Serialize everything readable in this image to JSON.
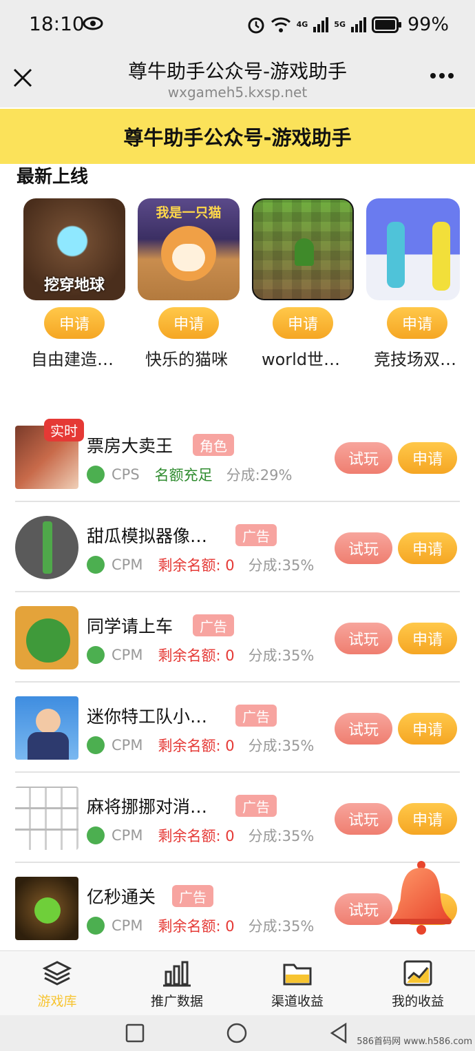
{
  "status_bar": {
    "time": "18:10",
    "battery_pct": "99%",
    "network_1": "4G",
    "network_2": "5G"
  },
  "title_bar": {
    "title": "尊牛助手公众号-游戏助手",
    "url": "wxgameh5.kxsp.net"
  },
  "banner": {
    "text": "尊牛助手公众号-游戏助手"
  },
  "newest": {
    "title": "最新上线",
    "items": [
      {
        "name": "自由建造…",
        "button": "申请",
        "thumb_text": "挖穿地球"
      },
      {
        "name": "快乐的猫咪",
        "button": "申请",
        "thumb_text": "我是一只猫"
      },
      {
        "name": "world世…",
        "button": "申请",
        "thumb_text": ""
      },
      {
        "name": "竞技场双…",
        "button": "申请",
        "thumb_text": ""
      }
    ]
  },
  "games": [
    {
      "name": "票房大卖王",
      "tag": "角色",
      "badge": "实时",
      "type": "CPS",
      "quota": "名额充足",
      "quota_color": "#2e8b2e",
      "share": "分成:29%",
      "try": "试玩",
      "apply": "申请"
    },
    {
      "name": "甜瓜模拟器像…",
      "tag": "广告",
      "badge": "",
      "type": "CPM",
      "quota": "剩余名额: 0",
      "quota_color": "#e53935",
      "share": "分成:35%",
      "try": "试玩",
      "apply": "申请"
    },
    {
      "name": "同学请上车",
      "tag": "广告",
      "badge": "",
      "type": "CPM",
      "quota": "剩余名额: 0",
      "quota_color": "#e53935",
      "share": "分成:35%",
      "try": "试玩",
      "apply": "申请"
    },
    {
      "name": "迷你特工队小…",
      "tag": "广告",
      "badge": "",
      "type": "CPM",
      "quota": "剩余名额: 0",
      "quota_color": "#e53935",
      "share": "分成:35%",
      "try": "试玩",
      "apply": "申请"
    },
    {
      "name": "麻将挪挪对消…",
      "tag": "广告",
      "badge": "",
      "type": "CPM",
      "quota": "剩余名额: 0",
      "quota_color": "#e53935",
      "share": "分成:35%",
      "try": "试玩",
      "apply": "申请"
    },
    {
      "name": "亿秒通关",
      "tag": "广告",
      "badge": "",
      "type": "CPM",
      "quota": "剩余名额: 0",
      "quota_color": "#e53935",
      "share": "分成:35%",
      "try": "试玩",
      "apply": "申请"
    }
  ],
  "tabs": [
    {
      "label": "游戏库",
      "icon": "layers-icon",
      "active": true
    },
    {
      "label": "推广数据",
      "icon": "bar-chart-icon",
      "active": false
    },
    {
      "label": "渠道收益",
      "icon": "folder-icon",
      "active": false
    },
    {
      "label": "我的收益",
      "icon": "trend-chart-icon",
      "active": false
    }
  ],
  "watermark": "586首码网 www.h586.com",
  "colors": {
    "accent_yellow": "#fbe25a",
    "button_orange": "#f5a623",
    "button_salmon": "#ef7e70",
    "tag_pink": "#f7a4a0"
  }
}
